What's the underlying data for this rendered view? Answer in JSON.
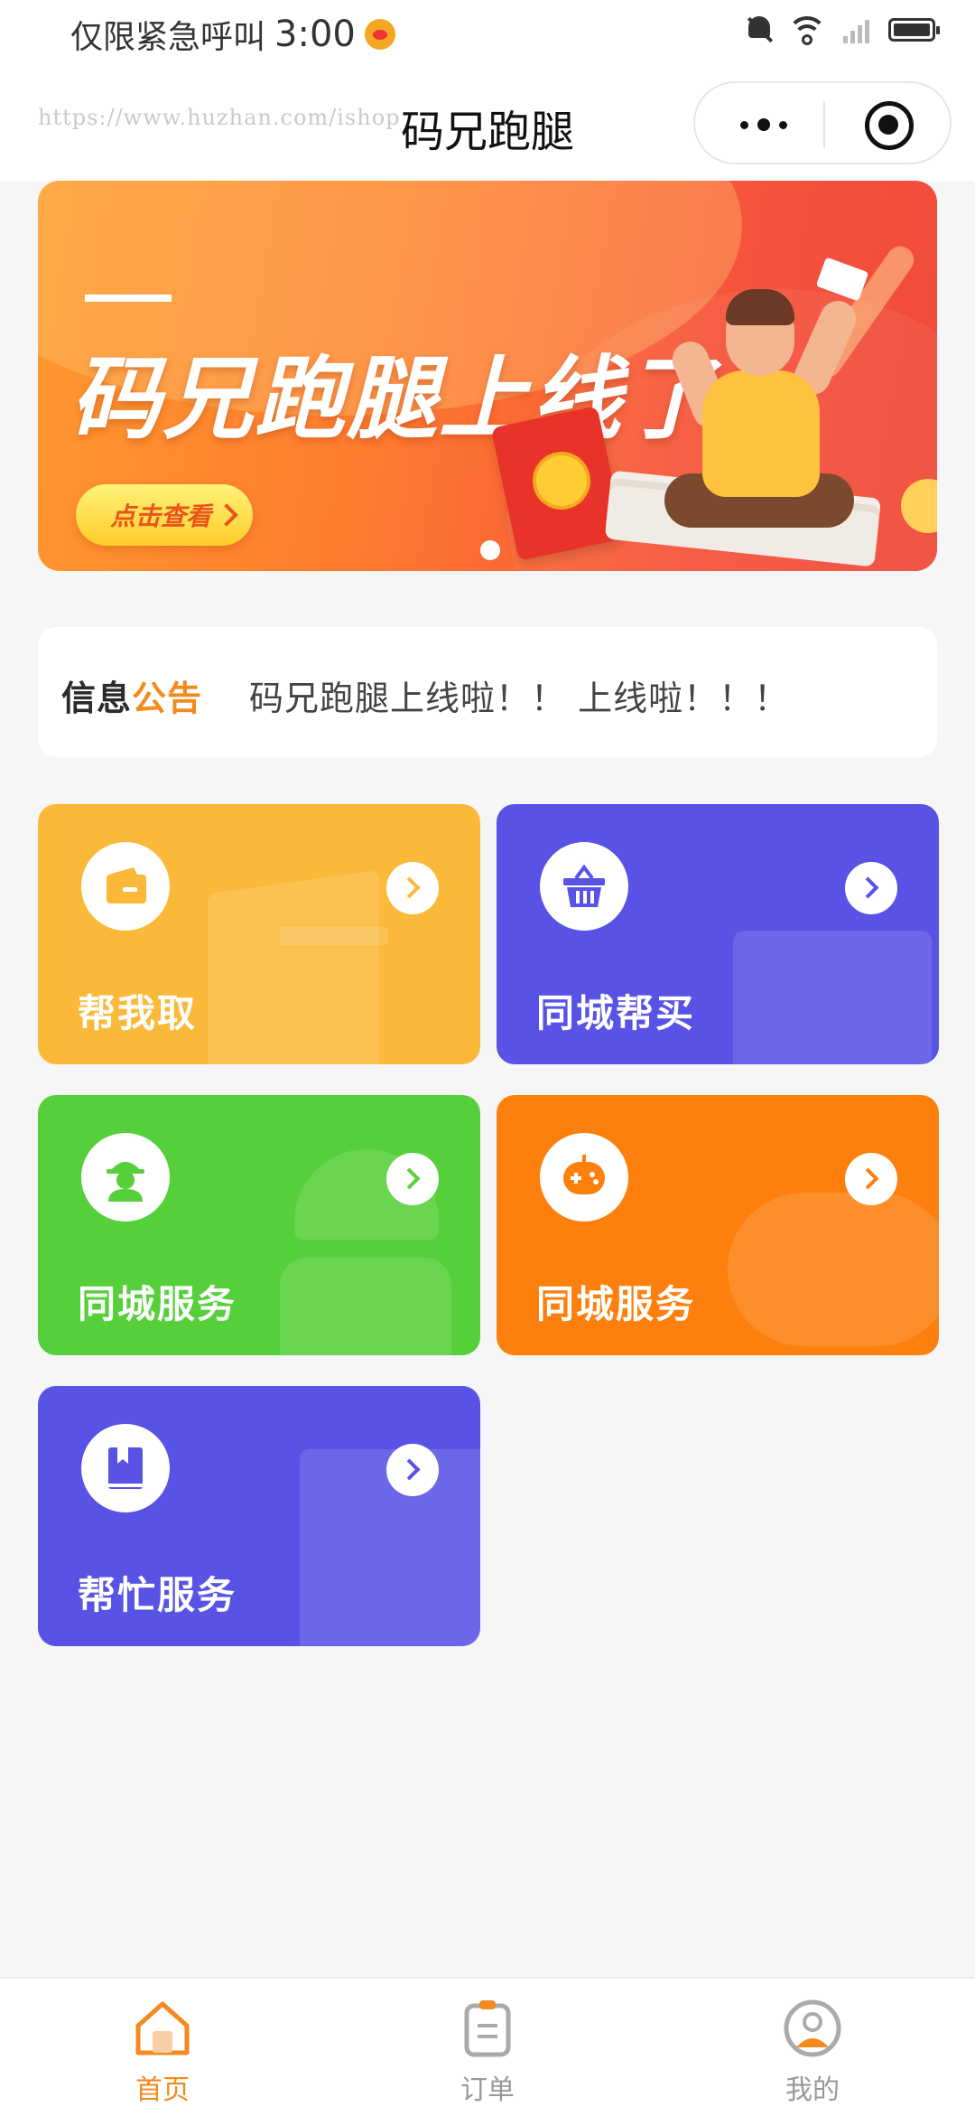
{
  "status_bar": {
    "carrier": "仅限紧急呼叫",
    "time": "3:00"
  },
  "nav": {
    "watermark_url": "https://www.huzhan.com/ishop",
    "title": "码兄跑腿"
  },
  "banner": {
    "headline": "码兄跑腿上线了",
    "button_label": "点击查看",
    "page_index": 1,
    "page_count": 1
  },
  "notice": {
    "badge_part1": "信息",
    "badge_part2": "公告",
    "text": "码兄跑腿上线啦！！ 上线啦！！！"
  },
  "services": [
    {
      "label": "帮我取",
      "icon": "wallet-icon",
      "color": "#fbb93a"
    },
    {
      "label": "同城帮买",
      "icon": "basket-icon",
      "color": "#5852e5"
    },
    {
      "label": "同城服务",
      "icon": "worker-icon",
      "color": "#55d03a"
    },
    {
      "label": "同城服务",
      "icon": "gamepad-icon",
      "color": "#fd800e"
    },
    {
      "label": "帮忙服务",
      "icon": "book-icon",
      "color": "#5852e5"
    }
  ],
  "tabbar": {
    "items": [
      {
        "label": "首页",
        "icon": "home-icon",
        "active": true
      },
      {
        "label": "订单",
        "icon": "order-icon",
        "active": false
      },
      {
        "label": "我的",
        "icon": "profile-icon",
        "active": false
      }
    ]
  },
  "colors": {
    "accent": "#f28a1e",
    "background": "#f6f6f7"
  }
}
